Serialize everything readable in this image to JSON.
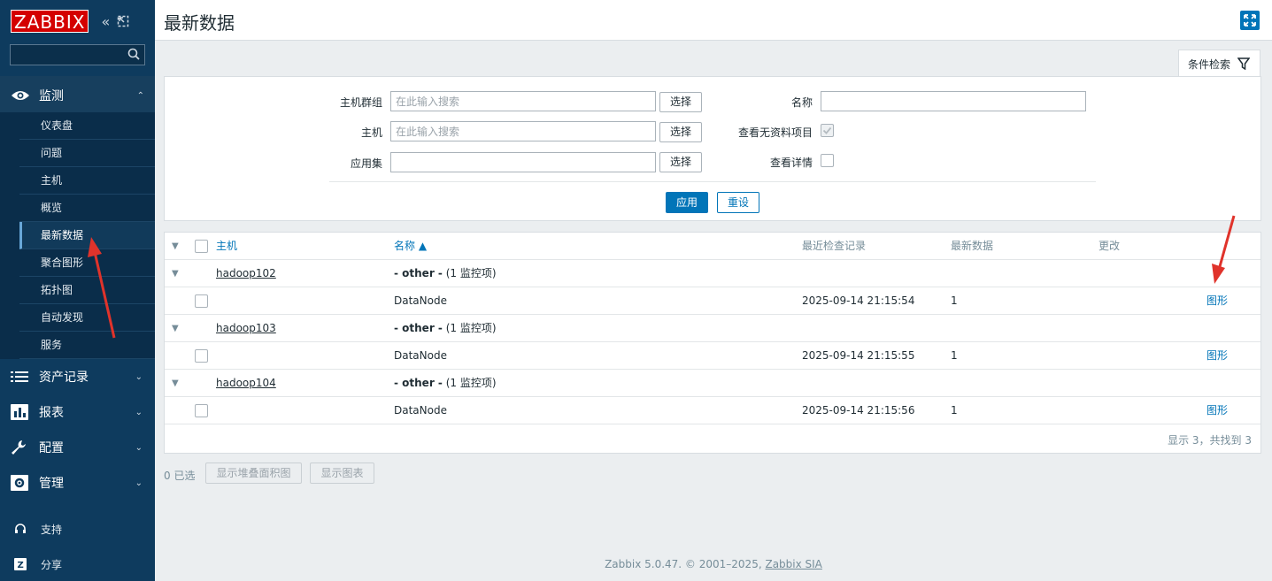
{
  "sidebar": {
    "logo": "ZABBIX",
    "search": {
      "value": "",
      "placeholder": ""
    },
    "monitoring": {
      "label": "监测",
      "items": [
        "仪表盘",
        "问题",
        "主机",
        "概览",
        "最新数据",
        "聚合图形",
        "拓扑图",
        "自动发现",
        "服务"
      ],
      "active_index": 4
    },
    "sections": [
      "资产记录",
      "报表",
      "配置",
      "管理"
    ],
    "footer_items": [
      "支持",
      "分享"
    ]
  },
  "header": {
    "title": "最新数据"
  },
  "filter": {
    "tab_label": "条件检索",
    "host_group_label": "主机群组",
    "host_label": "主机",
    "app_label": "应用集",
    "search_placeholder": "在此输入搜索",
    "select_label": "选择",
    "name_label": "名称",
    "name_value": "",
    "show_without_data_label": "查看无资料项目",
    "show_without_data_checked": true,
    "show_details_label": "查看详情",
    "show_details_checked": false,
    "apply_label": "应用",
    "reset_label": "重设"
  },
  "table": {
    "headers": {
      "host": "主机",
      "name": "名称 ▲",
      "last_check": "最近检查记录",
      "last_value": "最新数据",
      "change": "更改"
    },
    "groups": [
      {
        "host": "hadoop102",
        "app": "- other -",
        "app_count": "(1 监控项)",
        "item": "DataNode",
        "last_check": "2025-09-14 21:15:54",
        "last_value": "1",
        "graph": "图形"
      },
      {
        "host": "hadoop103",
        "app": "- other -",
        "app_count": "(1 监控项)",
        "item": "DataNode",
        "last_check": "2025-09-14 21:15:55",
        "last_value": "1",
        "graph": "图形"
      },
      {
        "host": "hadoop104",
        "app": "- other -",
        "app_count": "(1 监控项)",
        "item": "DataNode",
        "last_check": "2025-09-14 21:15:56",
        "last_value": "1",
        "graph": "图形"
      }
    ],
    "summary": "显示 3，共找到 3"
  },
  "actions": {
    "selected": "0 已选",
    "stacked_graph": "显示堆叠面积图",
    "show_graph": "显示图表"
  },
  "footer": {
    "text": "Zabbix 5.0.47. © 2001–2025, ",
    "link": "Zabbix SIA"
  },
  "colors": {
    "sidebar": "#0e3b5e",
    "accent": "#0275b8",
    "logo_red": "#d40000",
    "annotation_arrow": "#e0332b"
  }
}
